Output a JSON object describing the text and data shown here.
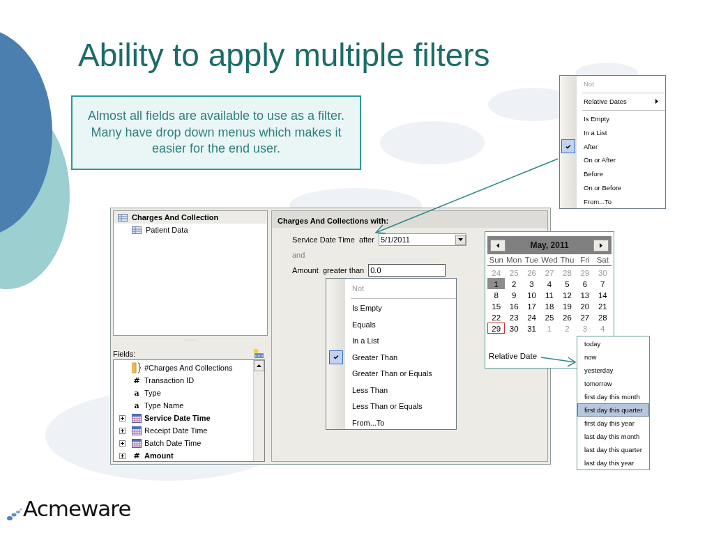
{
  "title": "Ability to apply multiple filters",
  "callout": "Almost all fields are available to use as a filter. Many have drop down menus which makes it easier for the end user.",
  "window": {
    "tree": [
      {
        "label": "Charges And Collection",
        "children": [
          {
            "label": "Patient Data"
          }
        ]
      }
    ],
    "fields_label": "Fields:",
    "fields": [
      {
        "label": "#Charges And Collections",
        "kind": "group",
        "bold": false,
        "expander": false
      },
      {
        "label": "Transaction ID",
        "kind": "glyph",
        "glyph": "#",
        "bold": false,
        "expander": false
      },
      {
        "label": "Type",
        "kind": "glyph",
        "glyph": "a",
        "bold": false,
        "expander": false
      },
      {
        "label": "Type Name",
        "kind": "glyph",
        "glyph": "a",
        "bold": false,
        "expander": false
      },
      {
        "label": "Service Date Time",
        "kind": "date",
        "bold": true,
        "expander": true
      },
      {
        "label": "Receipt Date Time",
        "kind": "date",
        "bold": false,
        "expander": true
      },
      {
        "label": "Batch Date Time",
        "kind": "date",
        "bold": false,
        "expander": true
      },
      {
        "label": "Amount",
        "kind": "glyph",
        "glyph": "#",
        "bold": true,
        "expander": true
      }
    ],
    "filter": {
      "header": "Charges And Collections with:",
      "rows": [
        {
          "kind": "dropdown_condition",
          "field": "Service Date Time",
          "operator": "after",
          "value": "5/1/2011"
        },
        {
          "kind": "conjunction",
          "text": "and"
        },
        {
          "kind": "text_condition",
          "field": "Amount",
          "operator": "greater than",
          "value": "0.0"
        }
      ]
    }
  },
  "operator_menu": [
    {
      "label": "Not",
      "disabled": true,
      "selected": false,
      "separator_after": true
    },
    {
      "label": "Is Empty",
      "disabled": false,
      "selected": false,
      "separator_after": false
    },
    {
      "label": "Equals",
      "disabled": false,
      "selected": false,
      "separator_after": false
    },
    {
      "label": "In a List",
      "disabled": false,
      "selected": false,
      "separator_after": false
    },
    {
      "label": "Greater Than",
      "disabled": false,
      "selected": true,
      "separator_after": false
    },
    {
      "label": "Greater Than or Equals",
      "disabled": false,
      "selected": false,
      "separator_after": false
    },
    {
      "label": "Less Than",
      "disabled": false,
      "selected": false,
      "separator_after": false
    },
    {
      "label": "Less Than or Equals",
      "disabled": false,
      "selected": false,
      "separator_after": false
    },
    {
      "label": "From...To",
      "disabled": false,
      "selected": false,
      "separator_after": false
    }
  ],
  "calendar": {
    "month": "May, 2011",
    "weekdays": [
      "Sun",
      "Mon",
      "Tue",
      "Wed",
      "Thu",
      "Fri",
      "Sat"
    ],
    "days": [
      {
        "label": "24",
        "other_month": true,
        "selected": false,
        "today": false
      },
      {
        "label": "25",
        "other_month": true,
        "selected": false,
        "today": false
      },
      {
        "label": "26",
        "other_month": true,
        "selected": false,
        "today": false
      },
      {
        "label": "27",
        "other_month": true,
        "selected": false,
        "today": false
      },
      {
        "label": "28",
        "other_month": true,
        "selected": false,
        "today": false
      },
      {
        "label": "29",
        "other_month": true,
        "selected": false,
        "today": false
      },
      {
        "label": "30",
        "other_month": true,
        "selected": false,
        "today": false
      },
      {
        "label": "1",
        "other_month": false,
        "selected": true,
        "today": false
      },
      {
        "label": "2",
        "other_month": false,
        "selected": false,
        "today": false
      },
      {
        "label": "3",
        "other_month": false,
        "selected": false,
        "today": false
      },
      {
        "label": "4",
        "other_month": false,
        "selected": false,
        "today": false
      },
      {
        "label": "5",
        "other_month": false,
        "selected": false,
        "today": false
      },
      {
        "label": "6",
        "other_month": false,
        "selected": false,
        "today": false
      },
      {
        "label": "7",
        "other_month": false,
        "selected": false,
        "today": false
      },
      {
        "label": "8",
        "other_month": false,
        "selected": false,
        "today": false
      },
      {
        "label": "9",
        "other_month": false,
        "selected": false,
        "today": false
      },
      {
        "label": "10",
        "other_month": false,
        "selected": false,
        "today": false
      },
      {
        "label": "11",
        "other_month": false,
        "selected": false,
        "today": false
      },
      {
        "label": "12",
        "other_month": false,
        "selected": false,
        "today": false
      },
      {
        "label": "13",
        "other_month": false,
        "selected": false,
        "today": false
      },
      {
        "label": "14",
        "other_month": false,
        "selected": false,
        "today": false
      },
      {
        "label": "15",
        "other_month": false,
        "selected": false,
        "today": false
      },
      {
        "label": "16",
        "other_month": false,
        "selected": false,
        "today": false
      },
      {
        "label": "17",
        "other_month": false,
        "selected": false,
        "today": false
      },
      {
        "label": "18",
        "other_month": false,
        "selected": false,
        "today": false
      },
      {
        "label": "19",
        "other_month": false,
        "selected": false,
        "today": false
      },
      {
        "label": "20",
        "other_month": false,
        "selected": false,
        "today": false
      },
      {
        "label": "21",
        "other_month": false,
        "selected": false,
        "today": false
      },
      {
        "label": "22",
        "other_month": false,
        "selected": false,
        "today": false
      },
      {
        "label": "23",
        "other_month": false,
        "selected": false,
        "today": false
      },
      {
        "label": "24",
        "other_month": false,
        "selected": false,
        "today": false
      },
      {
        "label": "25",
        "other_month": false,
        "selected": false,
        "today": false
      },
      {
        "label": "26",
        "other_month": false,
        "selected": false,
        "today": false
      },
      {
        "label": "27",
        "other_month": false,
        "selected": false,
        "today": false
      },
      {
        "label": "28",
        "other_month": false,
        "selected": false,
        "today": false
      },
      {
        "label": "29",
        "other_month": false,
        "selected": false,
        "today": true
      },
      {
        "label": "30",
        "other_month": false,
        "selected": false,
        "today": false
      },
      {
        "label": "31",
        "other_month": false,
        "selected": false,
        "today": false
      },
      {
        "label": "1",
        "other_month": true,
        "selected": false,
        "today": false
      },
      {
        "label": "2",
        "other_month": true,
        "selected": false,
        "today": false
      },
      {
        "label": "3",
        "other_month": true,
        "selected": false,
        "today": false
      },
      {
        "label": "4",
        "other_month": true,
        "selected": false,
        "today": false
      }
    ],
    "relative_label": "Relative Date"
  },
  "relative_menu": [
    {
      "label": "today",
      "selected": false
    },
    {
      "label": "now",
      "selected": false
    },
    {
      "label": "yesterday",
      "selected": false
    },
    {
      "label": "tomorrow",
      "selected": false
    },
    {
      "label": "first day this month",
      "selected": false
    },
    {
      "label": "first day this quarter",
      "selected": true
    },
    {
      "label": "first day this year",
      "selected": false
    },
    {
      "label": "last day this month",
      "selected": false
    },
    {
      "label": "last day this quarter",
      "selected": false
    },
    {
      "label": "last day this year",
      "selected": false
    }
  ],
  "date_menu": [
    {
      "label": "Not",
      "disabled": true,
      "selected": false,
      "submenu": false,
      "separator_after": true
    },
    {
      "label": "Relative Dates",
      "disabled": false,
      "selected": false,
      "submenu": true,
      "separator_after": true
    },
    {
      "label": "Is Empty",
      "disabled": false,
      "selected": false,
      "submenu": false,
      "separator_after": false
    },
    {
      "label": "In a List",
      "disabled": false,
      "selected": false,
      "submenu": false,
      "separator_after": false
    },
    {
      "label": "After",
      "disabled": false,
      "selected": true,
      "submenu": false,
      "separator_after": false
    },
    {
      "label": "On or After",
      "disabled": false,
      "selected": false,
      "submenu": false,
      "separator_after": false
    },
    {
      "label": "Before",
      "disabled": false,
      "selected": false,
      "submenu": false,
      "separator_after": false
    },
    {
      "label": "On or Before",
      "disabled": false,
      "selected": false,
      "submenu": false,
      "separator_after": false
    },
    {
      "label": "From...To",
      "disabled": false,
      "selected": false,
      "submenu": false,
      "separator_after": false
    }
  ],
  "logo": "Acmeware"
}
